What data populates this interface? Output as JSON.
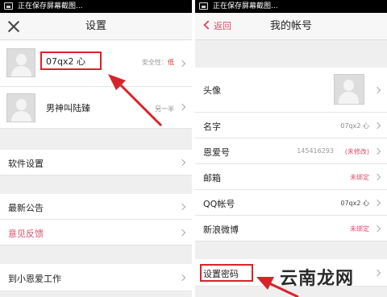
{
  "status_bar": {
    "text": "正在保存屏幕截图..."
  },
  "left": {
    "title": "设置",
    "accounts": [
      {
        "name": "07qx2 心",
        "meta_label": "安全性：",
        "meta_value": "低"
      },
      {
        "name": "男神叫陆臻",
        "meta_label": "另一半",
        "meta_value": ""
      }
    ],
    "items": [
      {
        "label": "软件设置"
      },
      {
        "label": "最新公告"
      },
      {
        "label": "意见反馈"
      },
      {
        "label": "到小恩爱工作"
      }
    ]
  },
  "right": {
    "back_label": "返回",
    "title": "我的帐号",
    "rows": [
      {
        "label": "头像",
        "value": ""
      },
      {
        "label": "名字",
        "value": "07qx2 心"
      },
      {
        "label": "恩爱号",
        "value": "145416293",
        "note": "(未修改)"
      },
      {
        "label": "邮箱",
        "value": "未绑定"
      },
      {
        "label": "QQ帐号",
        "value": "07qx2 心"
      },
      {
        "label": "新浪微博",
        "value": "未绑定"
      },
      {
        "label": "设置密码",
        "value": ""
      }
    ]
  },
  "watermark": "云南龙网",
  "colors": {
    "accent": "#d94f6e",
    "highlight_box": "#d8232a",
    "status_bar": "#000000"
  }
}
